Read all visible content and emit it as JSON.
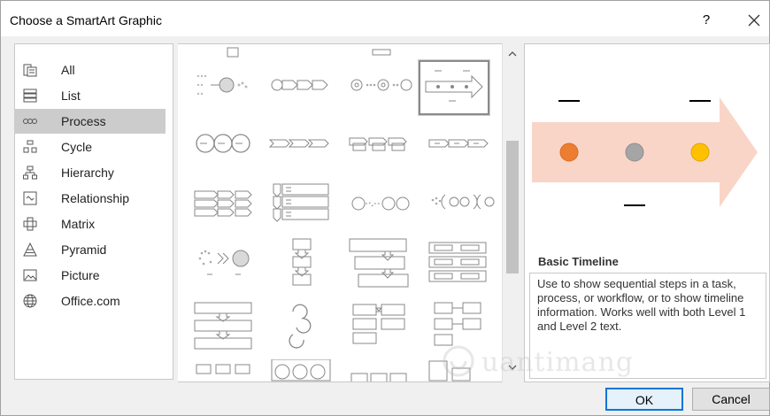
{
  "dialog": {
    "title": "Choose a SmartArt Graphic",
    "help_label": "?",
    "ok_label": "OK",
    "cancel_label": "Cancel"
  },
  "sidebar": {
    "items": [
      {
        "label": "All",
        "icon": "all-icon"
      },
      {
        "label": "List",
        "icon": "list-icon"
      },
      {
        "label": "Process",
        "icon": "process-icon",
        "selected": true
      },
      {
        "label": "Cycle",
        "icon": "cycle-icon"
      },
      {
        "label": "Hierarchy",
        "icon": "hierarchy-icon"
      },
      {
        "label": "Relationship",
        "icon": "relationship-icon"
      },
      {
        "label": "Matrix",
        "icon": "matrix-icon"
      },
      {
        "label": "Pyramid",
        "icon": "pyramid-icon"
      },
      {
        "label": "Picture",
        "icon": "picture-icon"
      },
      {
        "label": "Office.com",
        "icon": "globe-icon"
      }
    ]
  },
  "preview": {
    "title": "Basic Timeline",
    "description": "Use to show sequential steps in a task, process, or workflow, or to show timeline information. Works well with both Level 1 and Level 2 text.",
    "colors": {
      "arrow": "#f9d5c8",
      "dot1": "#ed7d31",
      "dot2": "#a5a5a5",
      "dot3": "#ffc000"
    }
  },
  "watermark": {
    "text": "uantimang"
  }
}
